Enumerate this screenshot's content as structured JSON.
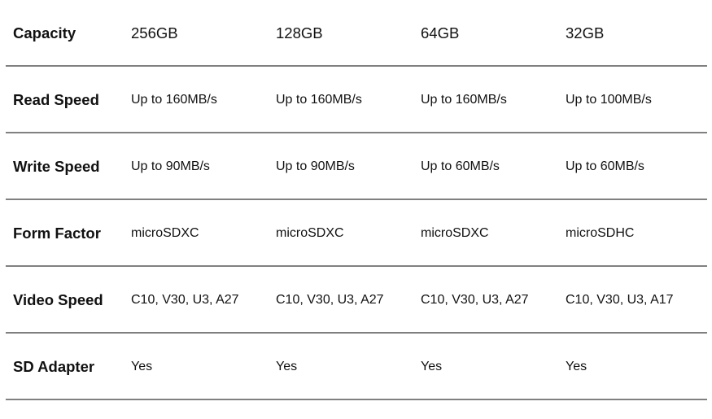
{
  "table": {
    "rows": [
      {
        "label": "Capacity",
        "values": [
          "256GB",
          "128GB",
          "64GB",
          "32GB"
        ]
      },
      {
        "label": "Read Speed",
        "values": [
          "Up to 160MB/s",
          "Up to 160MB/s",
          "Up to 160MB/s",
          "Up to 100MB/s"
        ]
      },
      {
        "label": "Write Speed",
        "values": [
          "Up to 90MB/s",
          "Up to 90MB/s",
          "Up to 60MB/s",
          "Up to 60MB/s"
        ]
      },
      {
        "label": "Form Factor",
        "values": [
          "microSDXC",
          "microSDXC",
          "microSDXC",
          "microSDHC"
        ]
      },
      {
        "label": "Video Speed",
        "values": [
          "C10, V30, U3, A27",
          "C10, V30, U3, A27",
          "C10, V30, U3, A27",
          "C10, V30, U3, A17"
        ]
      },
      {
        "label": "SD Adapter",
        "values": [
          "Yes",
          "Yes",
          "Yes",
          "Yes"
        ]
      }
    ]
  },
  "colors": {
    "divider": "#808080",
    "text": "#111111",
    "background": "#ffffff"
  }
}
